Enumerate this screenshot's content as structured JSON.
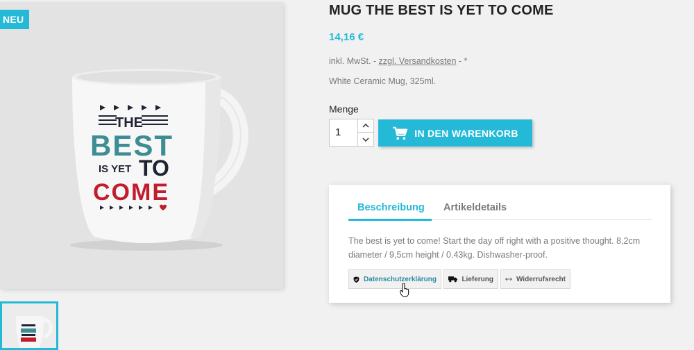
{
  "product": {
    "badge": "NEU",
    "title": "MUG THE BEST IS YET TO COME",
    "price": "14,16 €",
    "tax_prefix": "inkl. MwSt. -",
    "shipping_link": "zzgl. Versandkosten",
    "tax_suffix": " - *",
    "short_description": "White Ceramic Mug, 325ml.",
    "mug_print": {
      "line1": "THE",
      "line2": "BEST",
      "line3a": "IS YET",
      "line3b": "TO",
      "line4": "COME"
    }
  },
  "purchase": {
    "quantity_label": "Menge",
    "quantity_value": "1",
    "add_to_cart_label": "IN DEN WARENKORB"
  },
  "tabs": {
    "items": [
      {
        "label": "Beschreibung",
        "active": true
      },
      {
        "label": "Artikeldetails",
        "active": false
      }
    ],
    "description": "The best is yet to come! Start the day off right with a positive thought. 8,2cm diameter / 9,5cm height / 0.43kg. Dishwasher-proof."
  },
  "info_buttons": [
    {
      "label": "Datenschutzerklärung",
      "icon": "shield-icon"
    },
    {
      "label": "Lieferung",
      "icon": "truck-icon"
    },
    {
      "label": "Widerrufsrecht",
      "icon": "arrows-icon"
    }
  ],
  "colors": {
    "accent": "#24b9d7",
    "mug_teal": "#3e8d95",
    "mug_red": "#c21d2d",
    "mug_navy": "#1f2433"
  }
}
